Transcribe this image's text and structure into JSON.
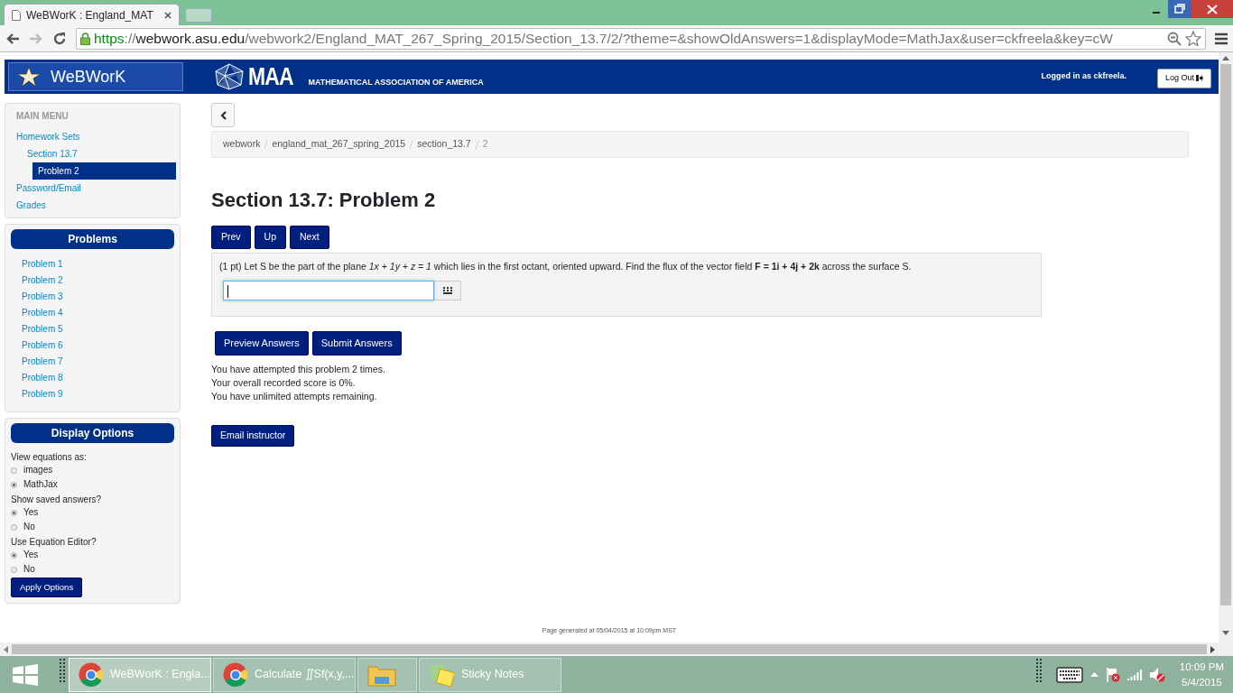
{
  "browser": {
    "tabs": [
      {
        "title": "WeBWorK : England_MAT",
        "selected": true
      }
    ],
    "url": [
      {
        "text": "https",
        "kind": "scheme"
      },
      {
        "text": "://",
        "kind": "sep"
      },
      {
        "text": "webwork.asu.edu",
        "kind": "host"
      },
      {
        "text": "/webwork2/England_MAT_267_Spring_2015/Section_13.7/2/?theme=&showOldAnswers=1&displayMode=MathJax&user=ckfreela&key=cW",
        "kind": "path"
      }
    ]
  },
  "header": {
    "logo": "WeBWorK",
    "maa": "MAA",
    "maa_name": "MATHEMATICAL ASSOCIATION OF AMERICA",
    "logged_in": "Logged in as ckfreela.",
    "logout": "Log Out"
  },
  "main_menu": {
    "title": "MAIN MENU",
    "items": [
      {
        "label": "Homework Sets",
        "selected": false,
        "children": [
          {
            "label": "Section 13.7",
            "selected": false,
            "children": [
              {
                "label": "Problem 2",
                "selected": true
              }
            ]
          }
        ]
      },
      {
        "label": "Password/Email",
        "selected": false
      },
      {
        "label": "Grades",
        "selected": false
      }
    ]
  },
  "problems": {
    "title": "Problems",
    "items": [
      "Problem 1",
      "Problem 2",
      "Problem 3",
      "Problem 4",
      "Problem 5",
      "Problem 6",
      "Problem 7",
      "Problem 8",
      "Problem 9"
    ]
  },
  "display_options": {
    "title": "Display Options",
    "groups": [
      {
        "label": "View equations as:",
        "options": [
          {
            "label": "images",
            "selected": false
          },
          {
            "label": "MathJax",
            "selected": true
          }
        ]
      },
      {
        "label": "Show saved answers?",
        "options": [
          {
            "label": "Yes",
            "selected": true
          },
          {
            "label": "No",
            "selected": false
          }
        ]
      },
      {
        "label": "Use Equation Editor?",
        "options": [
          {
            "label": "Yes",
            "selected": true
          },
          {
            "label": "No",
            "selected": false
          }
        ]
      }
    ],
    "apply": "Apply Options"
  },
  "breadcrumb": [
    {
      "text": "webwork",
      "kind": "link"
    },
    {
      "text": "england_mat_267_spring_2015",
      "kind": "link"
    },
    {
      "text": "section_13.7",
      "kind": "link"
    },
    {
      "text": "2",
      "kind": "current"
    }
  ],
  "heading": "Section 13.7: Problem 2",
  "nav_buttons": [
    "Prev",
    "Up",
    "Next"
  ],
  "problem": {
    "prompt": "(1 pt) Let S be the part of the plane *1x + 1y + z = 1* which lies in the first octant, oriented upward. Find the flux of the vector field **F = 1i + 4j + 2k** across the surface S.",
    "answer": {
      "focused": true
    }
  },
  "action_buttons": [
    "Preview Answers",
    "Submit Answers"
  ],
  "messages": [
    "You have attempted this problem 2 times.",
    "Your overall recorded score is 0%.",
    "You have unlimited attempts remaining."
  ],
  "email_button": "Email instructor",
  "footer": "Page generated at 05/04/2015 at 10:09pm MST",
  "taskbar": {
    "items": [
      {
        "label": "WeBWorK : Engla...",
        "kind": "chrome",
        "selected": true
      },
      {
        "label": "Calculate ∬Sf(x,y,...",
        "kind": "chrome",
        "selected": false
      },
      {
        "kind": "folder",
        "selected": false
      },
      {
        "label": "Sticky Notes",
        "kind": "notes",
        "selected": false
      }
    ],
    "time": "10:09 PM",
    "date": "5/4/2015"
  }
}
